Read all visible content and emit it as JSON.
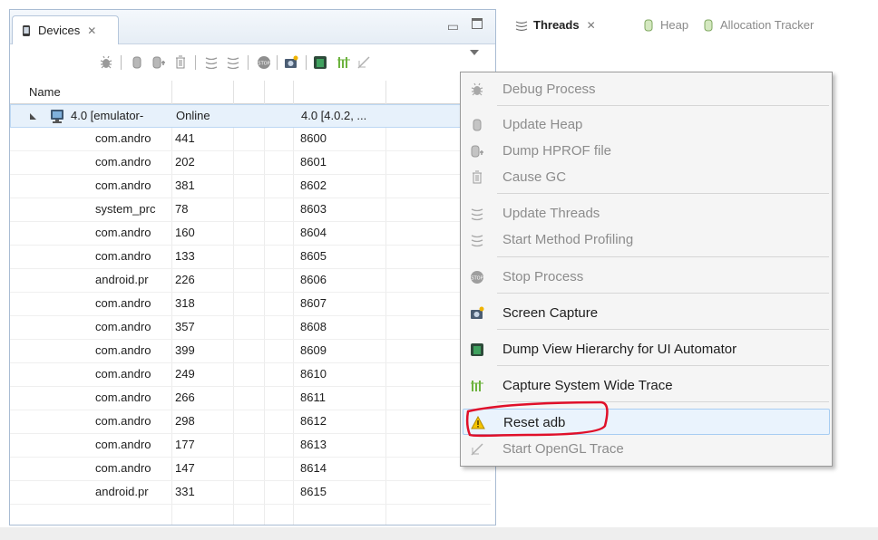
{
  "devices_view": {
    "tab_label": "Devices",
    "close_symbol": "✕",
    "minimize_symbol": "▭",
    "toolbar_icons": [
      "debug-bug-icon",
      "update-heap-icon",
      "dump-hprof-icon",
      "cause-gc-icon",
      "update-threads-icon",
      "method-profiling-icon",
      "stop-process-icon",
      "screen-capture-icon",
      "dump-view-hierarchy-icon",
      "system-trace-icon",
      "opengl-trace-icon"
    ]
  },
  "table": {
    "header_name": "Name",
    "device": {
      "name": "4.0 [emulator-",
      "status": "Online",
      "version": "4.0 [4.0.2, ..."
    },
    "processes": [
      {
        "name": "com.andro",
        "pid": "441",
        "port": "8600"
      },
      {
        "name": "com.andro",
        "pid": "202",
        "port": "8601"
      },
      {
        "name": "com.andro",
        "pid": "381",
        "port": "8602"
      },
      {
        "name": "system_prc",
        "pid": "78",
        "port": "8603"
      },
      {
        "name": "com.andro",
        "pid": "160",
        "port": "8604"
      },
      {
        "name": "com.andro",
        "pid": "133",
        "port": "8605"
      },
      {
        "name": "android.pr",
        "pid": "226",
        "port": "8606"
      },
      {
        "name": "com.andro",
        "pid": "318",
        "port": "8607"
      },
      {
        "name": "com.andro",
        "pid": "357",
        "port": "8608"
      },
      {
        "name": "com.andro",
        "pid": "399",
        "port": "8609"
      },
      {
        "name": "com.andro",
        "pid": "249",
        "port": "8610"
      },
      {
        "name": "com.andro",
        "pid": "266",
        "port": "8611"
      },
      {
        "name": "com.andro",
        "pid": "298",
        "port": "8612"
      },
      {
        "name": "com.andro",
        "pid": "177",
        "port": "8613"
      },
      {
        "name": "com.andro",
        "pid": "147",
        "port": "8614"
      },
      {
        "name": "android.pr",
        "pid": "331",
        "port": "8615"
      }
    ]
  },
  "right_tabs": {
    "threads": "Threads",
    "heap": "Heap",
    "allocation": "Allocation Tracker",
    "close_symbol": "✕"
  },
  "context_menu": {
    "items": [
      {
        "label": "Debug Process",
        "icon": "debug-bug-icon",
        "enabled": false
      },
      {
        "label": "Update Heap",
        "icon": "update-heap-icon",
        "enabled": false
      },
      {
        "label": "Dump HPROF file",
        "icon": "dump-hprof-icon",
        "enabled": false
      },
      {
        "label": "Cause GC",
        "icon": "cause-gc-icon",
        "enabled": false
      },
      {
        "label": "Update Threads",
        "icon": "update-threads-icon",
        "enabled": false
      },
      {
        "label": "Start Method Profiling",
        "icon": "method-profiling-icon",
        "enabled": false
      },
      {
        "label": "Stop Process",
        "icon": "stop-process-icon",
        "enabled": false
      },
      {
        "label": "Screen Capture",
        "icon": "screen-capture-icon",
        "enabled": true
      },
      {
        "label": "Dump View Hierarchy for UI Automator",
        "icon": "dump-view-hierarchy-icon",
        "enabled": true
      },
      {
        "label": "Capture System Wide Trace",
        "icon": "system-trace-icon",
        "enabled": true
      },
      {
        "label": "Reset adb",
        "icon": "warning-icon",
        "enabled": true,
        "highlighted": true
      },
      {
        "label": "Start OpenGL Trace",
        "icon": "opengl-trace-icon",
        "enabled": false
      }
    ]
  },
  "colors": {
    "selection_blue": "#e7f1fb",
    "annotation_red": "#e0102a",
    "disabled_text": "#8c8c8c"
  }
}
